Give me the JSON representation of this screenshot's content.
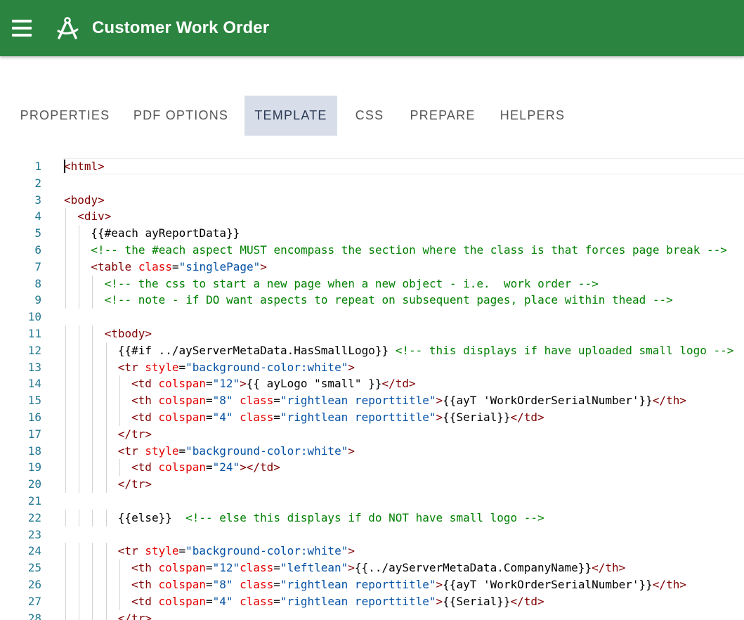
{
  "app": {
    "title": "Customer Work Order",
    "menu_icon": "menu-icon",
    "logo_icon": "compass-logo-icon",
    "header_color": "#2b8540"
  },
  "tabs": [
    {
      "label": "PROPERTIES",
      "active": false
    },
    {
      "label": "PDF OPTIONS",
      "active": false
    },
    {
      "label": "TEMPLATE",
      "active": true
    },
    {
      "label": "CSS",
      "active": false
    },
    {
      "label": "PREPARE",
      "active": false
    },
    {
      "label": "HELPERS",
      "active": false
    }
  ],
  "editor": {
    "language": "html",
    "cursor_line": 1,
    "lines": [
      {
        "n": 1,
        "indent": 0,
        "tokens": [
          [
            "tag",
            "<html>"
          ]
        ]
      },
      {
        "n": 2,
        "indent": 0,
        "tokens": []
      },
      {
        "n": 3,
        "indent": 0,
        "tokens": [
          [
            "tag",
            "<body>"
          ]
        ]
      },
      {
        "n": 4,
        "indent": 1,
        "tokens": [
          [
            "tag",
            "<div>"
          ]
        ]
      },
      {
        "n": 5,
        "indent": 2,
        "tokens": [
          [
            "text",
            "{{#each ayReportData}}"
          ]
        ]
      },
      {
        "n": 6,
        "indent": 2,
        "tokens": [
          [
            "com",
            "<!-- the #each aspect MUST encompass the section where the class is that forces page break -->"
          ]
        ]
      },
      {
        "n": 7,
        "indent": 2,
        "tokens": [
          [
            "tag",
            "<table "
          ],
          [
            "attr",
            "class"
          ],
          [
            "text",
            "="
          ],
          [
            "val",
            "\"singlePage\""
          ],
          [
            "tag",
            ">"
          ]
        ]
      },
      {
        "n": 8,
        "indent": 3,
        "tokens": [
          [
            "com",
            "<!-- the css to start a new page when a new object - i.e.  work order -->"
          ]
        ]
      },
      {
        "n": 9,
        "indent": 3,
        "tokens": [
          [
            "com",
            "<!-- note - if DO want aspects to repeat on subsequent pages, place within thead -->"
          ]
        ]
      },
      {
        "n": 10,
        "indent": 0,
        "tokens": []
      },
      {
        "n": 11,
        "indent": 3,
        "tokens": [
          [
            "tag",
            "<tbody>"
          ]
        ]
      },
      {
        "n": 12,
        "indent": 4,
        "tokens": [
          [
            "text",
            "{{#if ../ayServerMetaData.HasSmallLogo}} "
          ],
          [
            "com",
            "<!-- this displays if have uploaded small logo -->"
          ]
        ]
      },
      {
        "n": 13,
        "indent": 4,
        "tokens": [
          [
            "tag",
            "<tr "
          ],
          [
            "attr",
            "style"
          ],
          [
            "text",
            "="
          ],
          [
            "val",
            "\"background-color:white\""
          ],
          [
            "tag",
            ">"
          ]
        ]
      },
      {
        "n": 14,
        "indent": 5,
        "tokens": [
          [
            "tag",
            "<td "
          ],
          [
            "attr",
            "colspan"
          ],
          [
            "text",
            "="
          ],
          [
            "val",
            "\"12\""
          ],
          [
            "tag",
            ">"
          ],
          [
            "text",
            "{{ ayLogo \"small\" }}"
          ],
          [
            "tag",
            "</td>"
          ]
        ]
      },
      {
        "n": 15,
        "indent": 5,
        "tokens": [
          [
            "tag",
            "<th "
          ],
          [
            "attr",
            "colspan"
          ],
          [
            "text",
            "="
          ],
          [
            "val",
            "\"8\""
          ],
          [
            "text",
            " "
          ],
          [
            "attr",
            "class"
          ],
          [
            "text",
            "="
          ],
          [
            "val",
            "\"rightlean reporttitle\""
          ],
          [
            "tag",
            ">"
          ],
          [
            "text",
            "{{ayT 'WorkOrderSerialNumber'}}"
          ],
          [
            "tag",
            "</th>"
          ]
        ]
      },
      {
        "n": 16,
        "indent": 5,
        "tokens": [
          [
            "tag",
            "<td "
          ],
          [
            "attr",
            "colspan"
          ],
          [
            "text",
            "="
          ],
          [
            "val",
            "\"4\""
          ],
          [
            "text",
            " "
          ],
          [
            "attr",
            "class"
          ],
          [
            "text",
            "="
          ],
          [
            "val",
            "\"rightlean reporttitle\""
          ],
          [
            "tag",
            ">"
          ],
          [
            "text",
            "{{Serial}}"
          ],
          [
            "tag",
            "</td>"
          ]
        ]
      },
      {
        "n": 17,
        "indent": 4,
        "tokens": [
          [
            "tag",
            "</tr>"
          ]
        ]
      },
      {
        "n": 18,
        "indent": 4,
        "tokens": [
          [
            "tag",
            "<tr "
          ],
          [
            "attr",
            "style"
          ],
          [
            "text",
            "="
          ],
          [
            "val",
            "\"background-color:white\""
          ],
          [
            "tag",
            ">"
          ]
        ]
      },
      {
        "n": 19,
        "indent": 5,
        "tokens": [
          [
            "tag",
            "<td "
          ],
          [
            "attr",
            "colspan"
          ],
          [
            "text",
            "="
          ],
          [
            "val",
            "\"24\""
          ],
          [
            "tag",
            "></td>"
          ]
        ]
      },
      {
        "n": 20,
        "indent": 4,
        "tokens": [
          [
            "tag",
            "</tr>"
          ]
        ]
      },
      {
        "n": 21,
        "indent": 0,
        "tokens": []
      },
      {
        "n": 22,
        "indent": 4,
        "tokens": [
          [
            "text",
            "{{else}}  "
          ],
          [
            "com",
            "<!-- else this displays if do NOT have small logo -->"
          ]
        ]
      },
      {
        "n": 23,
        "indent": 0,
        "tokens": []
      },
      {
        "n": 24,
        "indent": 4,
        "tokens": [
          [
            "tag",
            "<tr "
          ],
          [
            "attr",
            "style"
          ],
          [
            "text",
            "="
          ],
          [
            "val",
            "\"background-color:white\""
          ],
          [
            "tag",
            ">"
          ]
        ]
      },
      {
        "n": 25,
        "indent": 5,
        "tokens": [
          [
            "tag",
            "<th "
          ],
          [
            "attr",
            "colspan"
          ],
          [
            "text",
            "="
          ],
          [
            "val",
            "\"12\""
          ],
          [
            "attr",
            "class"
          ],
          [
            "text",
            "="
          ],
          [
            "val",
            "\"leftlean\""
          ],
          [
            "tag",
            ">"
          ],
          [
            "text",
            "{{../ayServerMetaData.CompanyName}}"
          ],
          [
            "tag",
            "</th>"
          ]
        ]
      },
      {
        "n": 26,
        "indent": 5,
        "tokens": [
          [
            "tag",
            "<th "
          ],
          [
            "attr",
            "colspan"
          ],
          [
            "text",
            "="
          ],
          [
            "val",
            "\"8\""
          ],
          [
            "text",
            " "
          ],
          [
            "attr",
            "class"
          ],
          [
            "text",
            "="
          ],
          [
            "val",
            "\"rightlean reporttitle\""
          ],
          [
            "tag",
            ">"
          ],
          [
            "text",
            "{{ayT 'WorkOrderSerialNumber'}}"
          ],
          [
            "tag",
            "</th>"
          ]
        ]
      },
      {
        "n": 27,
        "indent": 5,
        "tokens": [
          [
            "tag",
            "<td "
          ],
          [
            "attr",
            "colspan"
          ],
          [
            "text",
            "="
          ],
          [
            "val",
            "\"4\""
          ],
          [
            "text",
            " "
          ],
          [
            "attr",
            "class"
          ],
          [
            "text",
            "="
          ],
          [
            "val",
            "\"rightlean reporttitle\""
          ],
          [
            "tag",
            ">"
          ],
          [
            "text",
            "{{Serial}}"
          ],
          [
            "tag",
            "</td>"
          ]
        ]
      },
      {
        "n": 28,
        "indent": 4,
        "tokens": [
          [
            "tag",
            "</tr>"
          ]
        ]
      }
    ]
  }
}
